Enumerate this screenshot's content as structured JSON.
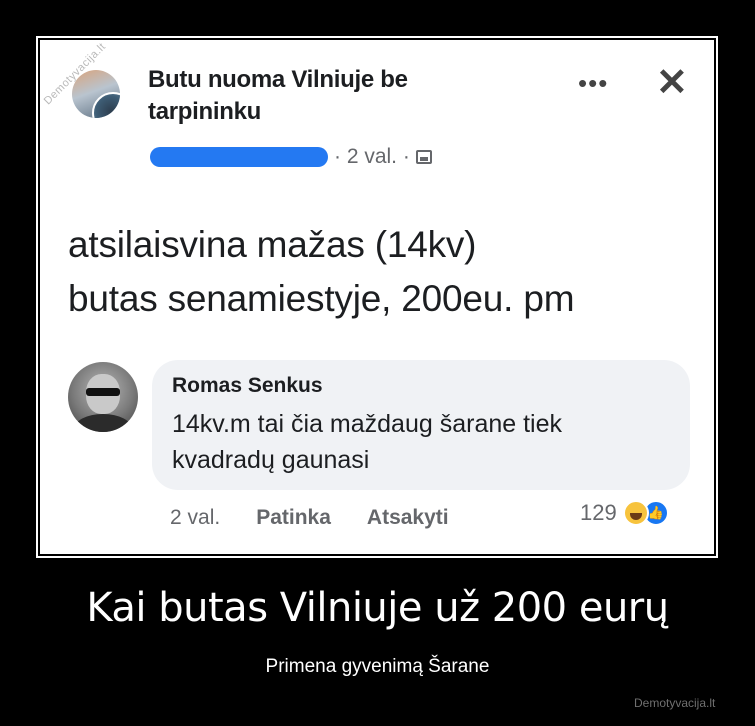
{
  "post": {
    "group_name": "Butu nuoma Vilniuje be tarpininku",
    "time": "· 2 val. ·",
    "text_line1": "atsilaisvina mažas (14kv)",
    "text_line2": "butas senamiestyje, 200eu. pm",
    "watermark": "Demotyvacija.lt",
    "more_label": "•••",
    "close_label": "✕"
  },
  "comment": {
    "author": "Romas Senkus",
    "text_line1": "14kv.m tai čia maždaug šarane tiek",
    "text_line2": "kvadradų gaunasi",
    "time": "2 val.",
    "like_label": "Patinka",
    "reply_label": "Atsakyti",
    "reaction_count": "129"
  },
  "caption": {
    "title": "Kai butas Vilniuje už 200 eurų",
    "subtitle": "Primena gyvenimą Šarane"
  },
  "site": "Demotyvacija.lt",
  "colors": {
    "background": "#000000",
    "redaction": "#2479f2",
    "like_blue": "#1877f2",
    "haha_yellow": "#f7c33d"
  }
}
